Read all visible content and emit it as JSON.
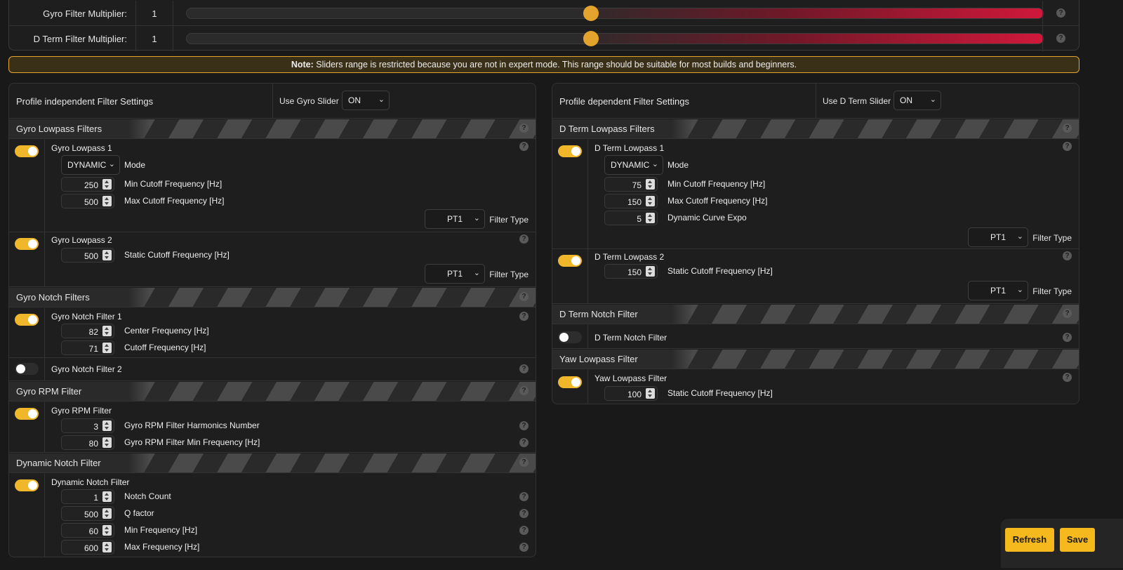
{
  "sliders": [
    {
      "label": "Gyro Filter Multiplier:",
      "value": "1",
      "position": 0.48
    },
    {
      "label": "D Term Filter Multiplier:",
      "value": "1",
      "position": 0.48
    }
  ],
  "note": {
    "bold": "Note:",
    "text": "Sliders range is restricted because you are not in expert mode. This range should be suitable for most builds and beginners."
  },
  "left": {
    "title": "Profile independent Filter Settings",
    "slider_label": "Use Gyro Slider",
    "slider_value": "ON",
    "sections": {
      "lowpass": "Gyro Lowpass Filters",
      "notch": "Gyro Notch Filters",
      "rpm": "Gyro RPM Filter",
      "dyn": "Dynamic Notch Filter"
    },
    "lp1": {
      "title": "Gyro Lowpass 1",
      "mode": "DYNAMIC",
      "mode_label": "Mode",
      "min": "250",
      "min_label": "Min Cutoff Frequency [Hz]",
      "max": "500",
      "max_label": "Max Cutoff Frequency [Hz]",
      "type": "PT1",
      "type_label": "Filter Type"
    },
    "lp2": {
      "title": "Gyro Lowpass 2",
      "cut": "500",
      "cut_label": "Static Cutoff Frequency [Hz]",
      "type": "PT1",
      "type_label": "Filter Type"
    },
    "n1": {
      "title": "Gyro Notch Filter 1",
      "center": "82",
      "center_label": "Center Frequency [Hz]",
      "cut": "71",
      "cut_label": "Cutoff Frequency [Hz]"
    },
    "n2": {
      "title": "Gyro Notch Filter 2"
    },
    "rpm": {
      "title": "Gyro RPM Filter",
      "harm": "3",
      "harm_label": "Gyro RPM Filter Harmonics Number",
      "minf": "80",
      "minf_label": "Gyro RPM Filter Min Frequency [Hz]"
    },
    "dyn": {
      "title": "Dynamic Notch Filter",
      "count": "1",
      "count_label": "Notch Count",
      "q": "500",
      "q_label": "Q factor",
      "minf": "60",
      "minf_label": "Min Frequency [Hz]",
      "maxf": "600",
      "maxf_label": "Max Frequency [Hz]"
    }
  },
  "right": {
    "title": "Profile dependent Filter Settings",
    "slider_label": "Use D Term Slider",
    "slider_value": "ON",
    "sections": {
      "lowpass": "D Term Lowpass Filters",
      "notch": "D Term Notch Filter",
      "yaw": "Yaw Lowpass Filter"
    },
    "lp1": {
      "title": "D Term Lowpass 1",
      "mode": "DYNAMIC",
      "mode_label": "Mode",
      "min": "75",
      "min_label": "Min Cutoff Frequency [Hz]",
      "max": "150",
      "max_label": "Max Cutoff Frequency [Hz]",
      "expo": "5",
      "expo_label": "Dynamic Curve Expo",
      "type": "PT1",
      "type_label": "Filter Type"
    },
    "lp2": {
      "title": "D Term Lowpass 2",
      "cut": "150",
      "cut_label": "Static Cutoff Frequency [Hz]",
      "type": "PT1",
      "type_label": "Filter Type"
    },
    "notch": {
      "title": "D Term Notch Filter"
    },
    "yaw": {
      "title": "Yaw Lowpass Filter",
      "cut": "100",
      "cut_label": "Static Cutoff Frequency [Hz]"
    }
  },
  "toggles": {
    "gyro_lp1": true,
    "gyro_lp2": true,
    "gyro_n1": true,
    "gyro_n2": false,
    "gyro_rpm": true,
    "dyn_notch": true,
    "dterm_lp1": true,
    "dterm_lp2": true,
    "dterm_notch": false,
    "yaw_lp": true
  },
  "help_glyph": "?",
  "buttons": {
    "refresh": "Refresh",
    "save": "Save"
  },
  "colors": {
    "accent": "#f5b81d",
    "note_border": "#e2a62c",
    "slider_red": "#d0183a"
  }
}
